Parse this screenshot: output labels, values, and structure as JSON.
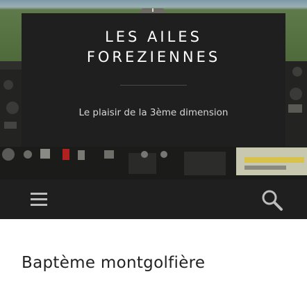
{
  "site": {
    "title_line1": "LES AILES",
    "title_line2": "FOREZIENNES",
    "tagline": "Le plaisir de la 3ème dimension"
  },
  "nav": {
    "menu_icon": "hamburger-menu-icon",
    "search_icon": "search-icon"
  },
  "post": {
    "title": "Baptème montgolfière"
  },
  "colors": {
    "header_bg": "#1f1f1f",
    "title_text": "#ffffff",
    "tagline_text": "#d7d7d7",
    "icon": "#bdbdbd",
    "post_title": "#222222"
  }
}
